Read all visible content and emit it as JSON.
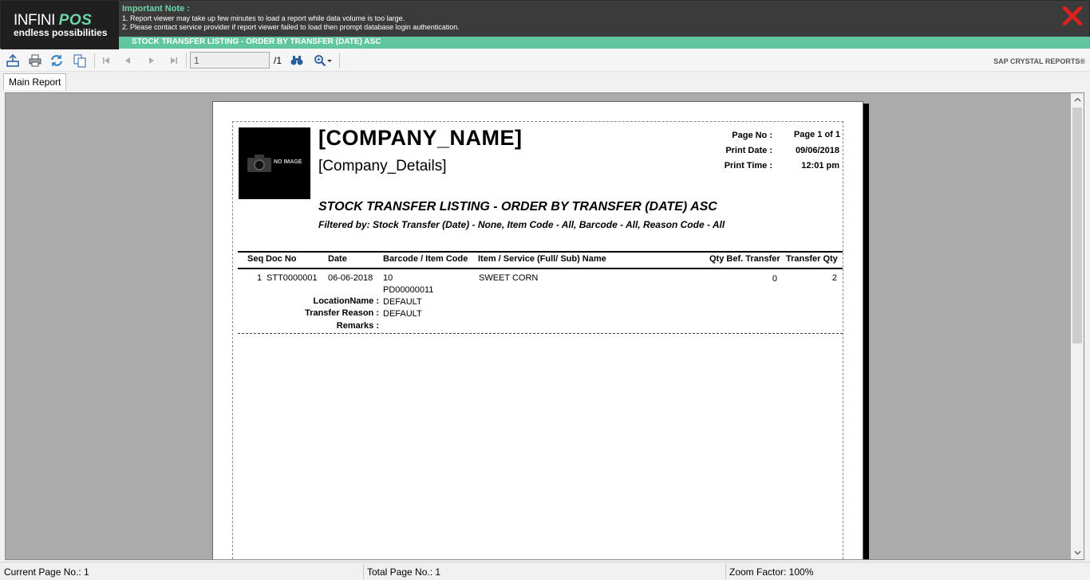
{
  "header": {
    "logo_line1_a": "INFINI",
    "logo_line1_b": "POS",
    "logo_line2": "endless possibilities",
    "note_title": "Important Note :",
    "note_line1": "1. Report viewer may take up few minutes to load a report while data volume is too large.",
    "note_line2": "2. Please contact service provider if report viewer failed to load then prompt database login authentication.",
    "subtitle": "STOCK TRANSFER LISTING - ORDER BY TRANSFER (DATE) ASC",
    "close_icon": "close-x-icon",
    "accent_color": "#5fc6a0",
    "close_color": "#e01f1f"
  },
  "toolbar": {
    "icons": [
      "export-icon",
      "print-icon",
      "refresh-icon",
      "copy-icon",
      "first-page-icon",
      "previous-page-icon",
      "next-page-icon",
      "last-page-icon",
      "find-icon",
      "zoom-icon"
    ],
    "page_value": "1",
    "page_total": "/1",
    "brand": "SAP CRYSTAL REPORTS®"
  },
  "tabs": {
    "main": "Main Report"
  },
  "report": {
    "logo_placeholder": "NO IMAGE",
    "company_name": "[COMPANY_NAME]",
    "company_details": "[Company_Details]",
    "page_no_label": "Page No :",
    "page_no_value": "Page 1 of 1",
    "print_date_label": "Print Date :",
    "print_date_value": "09/06/2018",
    "print_time_label": "Print Time :",
    "print_time_value": "12:01 pm",
    "title": "STOCK TRANSFER LISTING - ORDER BY TRANSFER (DATE) ASC",
    "filter": "Filtered by: Stock Transfer  (Date) - None, Item Code - All, Barcode - All, Reason Code - All",
    "columns": {
      "seq": "Seq",
      "doc_no": "Doc No",
      "date": "Date",
      "barcode": "Barcode / Item Code",
      "item_name": "Item / Service (Full/ Sub) Name",
      "qty_before": "Qty Bef. Transfer",
      "transfer_qty": "Transfer Qty"
    },
    "rows": [
      {
        "seq": "1",
        "doc_no": "STT0000001",
        "date": "06-06-2018",
        "barcode": "10",
        "item_code": "PD00000011",
        "item_name": "SWEET CORN",
        "qty_before": "0",
        "transfer_qty": "2",
        "location_label": "LocationName :",
        "location_value": "DEFAULT",
        "reason_label": "Transfer Reason :",
        "reason_value": "DEFAULT",
        "remarks_label": "Remarks :",
        "remarks_value": ""
      }
    ]
  },
  "status": {
    "current_page": "Current Page No.: 1",
    "total_page": "Total Page No.: 1",
    "zoom": "Zoom Factor: 100%"
  }
}
